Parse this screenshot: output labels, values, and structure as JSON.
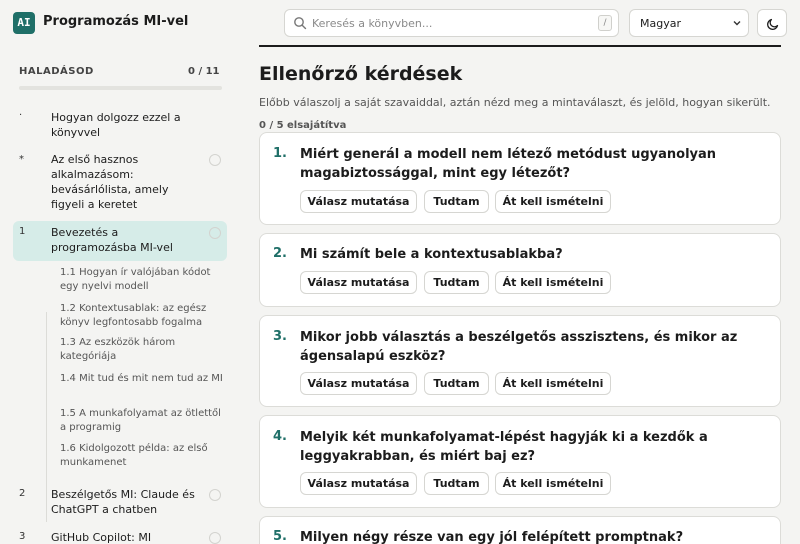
{
  "header": {
    "logo_text": "AI",
    "app_title": "Programozás MI-vel",
    "search_placeholder": "Keresés a könyvben...",
    "search_shortcut": "/",
    "language": "Magyar"
  },
  "sidebar": {
    "progress_title": "HALADÁSOD",
    "progress_count": "0 / 11",
    "progress_fraction": 0.0,
    "chapters": [
      {
        "num": "·",
        "label": "Hogyan dolgozz ezzel a könyvvel"
      },
      {
        "num": "*",
        "label": "Az első hasznos alkalmazásom: bevásárlólista, amely figyeli a keretet"
      },
      {
        "num": "1",
        "label": "Bevezetés a programozásba MI-vel"
      },
      {
        "num": "2",
        "label": "Beszélgetős MI: Claude és ChatGPT a chatben"
      },
      {
        "num": "3",
        "label": "GitHub Copilot: MI"
      }
    ],
    "subsections": [
      "1.1  Hogyan ír valójában kódot egy nyelvi modell",
      "1.2  Kontextusablak: az egész könyv legfontosabb fogalma",
      "1.3  Az eszközök három kategóriája",
      "1.4  Mit tud és mit nem tud az MI",
      "1.5  A munkafolyamat az ötlettől a programig",
      "1.6  Kidolgozott példa: az első munkamenet"
    ]
  },
  "main": {
    "title": "Ellenőrző kérdések",
    "description": "Előbb válaszolj a saját szavaiddal, aztán nézd meg a mintaválaszt, és jelöld, hogyan sikerült.",
    "mastered": "0 / 5 elsajátítva",
    "buttons": {
      "show": "Válasz mutatása",
      "knew": "Tudtam",
      "review": "Át kell ismételni"
    },
    "questions": [
      {
        "num": "1.",
        "text": "Miért generál a modell nem létező metódust ugyanolyan magabiztossággal, mint egy létezőt?"
      },
      {
        "num": "2.",
        "text": "Mi számít bele a kontextusablakba?"
      },
      {
        "num": "3.",
        "text": "Mikor jobb választás a beszélgetős asszisztens, és mikor az ágensalapú eszköz?"
      },
      {
        "num": "4.",
        "text": "Melyik két munkafolyamat-lépést hagyják ki a kezdők a leggyakrabban, és miért baj ez?"
      },
      {
        "num": "5.",
        "text": "Milyen négy része van egy jól felépített promptnak?"
      }
    ]
  },
  "colors": {
    "accent": "#1f6f68",
    "active_bg": "#d6ece8",
    "page_bg": "#f4f4f2"
  },
  "icons": {
    "search": "search-icon",
    "theme": "moon-icon",
    "language_caret": "chevron-down-icon"
  }
}
